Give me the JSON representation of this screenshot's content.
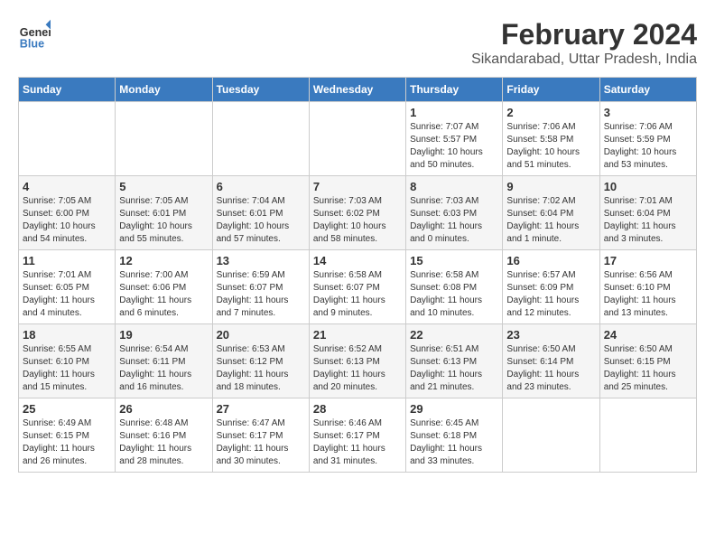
{
  "app": {
    "name_general": "General",
    "name_blue": "Blue",
    "title": "February 2024",
    "subtitle": "Sikandarabad, Uttar Pradesh, India"
  },
  "calendar": {
    "headers": [
      "Sunday",
      "Monday",
      "Tuesday",
      "Wednesday",
      "Thursday",
      "Friday",
      "Saturday"
    ],
    "weeks": [
      [
        {
          "day": "",
          "sunrise": "",
          "sunset": "",
          "daylight": ""
        },
        {
          "day": "",
          "sunrise": "",
          "sunset": "",
          "daylight": ""
        },
        {
          "day": "",
          "sunrise": "",
          "sunset": "",
          "daylight": ""
        },
        {
          "day": "",
          "sunrise": "",
          "sunset": "",
          "daylight": ""
        },
        {
          "day": "1",
          "sunrise": "Sunrise: 7:07 AM",
          "sunset": "Sunset: 5:57 PM",
          "daylight": "Daylight: 10 hours and 50 minutes."
        },
        {
          "day": "2",
          "sunrise": "Sunrise: 7:06 AM",
          "sunset": "Sunset: 5:58 PM",
          "daylight": "Daylight: 10 hours and 51 minutes."
        },
        {
          "day": "3",
          "sunrise": "Sunrise: 7:06 AM",
          "sunset": "Sunset: 5:59 PM",
          "daylight": "Daylight: 10 hours and 53 minutes."
        }
      ],
      [
        {
          "day": "4",
          "sunrise": "Sunrise: 7:05 AM",
          "sunset": "Sunset: 6:00 PM",
          "daylight": "Daylight: 10 hours and 54 minutes."
        },
        {
          "day": "5",
          "sunrise": "Sunrise: 7:05 AM",
          "sunset": "Sunset: 6:01 PM",
          "daylight": "Daylight: 10 hours and 55 minutes."
        },
        {
          "day": "6",
          "sunrise": "Sunrise: 7:04 AM",
          "sunset": "Sunset: 6:01 PM",
          "daylight": "Daylight: 10 hours and 57 minutes."
        },
        {
          "day": "7",
          "sunrise": "Sunrise: 7:03 AM",
          "sunset": "Sunset: 6:02 PM",
          "daylight": "Daylight: 10 hours and 58 minutes."
        },
        {
          "day": "8",
          "sunrise": "Sunrise: 7:03 AM",
          "sunset": "Sunset: 6:03 PM",
          "daylight": "Daylight: 11 hours and 0 minutes."
        },
        {
          "day": "9",
          "sunrise": "Sunrise: 7:02 AM",
          "sunset": "Sunset: 6:04 PM",
          "daylight": "Daylight: 11 hours and 1 minute."
        },
        {
          "day": "10",
          "sunrise": "Sunrise: 7:01 AM",
          "sunset": "Sunset: 6:04 PM",
          "daylight": "Daylight: 11 hours and 3 minutes."
        }
      ],
      [
        {
          "day": "11",
          "sunrise": "Sunrise: 7:01 AM",
          "sunset": "Sunset: 6:05 PM",
          "daylight": "Daylight: 11 hours and 4 minutes."
        },
        {
          "day": "12",
          "sunrise": "Sunrise: 7:00 AM",
          "sunset": "Sunset: 6:06 PM",
          "daylight": "Daylight: 11 hours and 6 minutes."
        },
        {
          "day": "13",
          "sunrise": "Sunrise: 6:59 AM",
          "sunset": "Sunset: 6:07 PM",
          "daylight": "Daylight: 11 hours and 7 minutes."
        },
        {
          "day": "14",
          "sunrise": "Sunrise: 6:58 AM",
          "sunset": "Sunset: 6:07 PM",
          "daylight": "Daylight: 11 hours and 9 minutes."
        },
        {
          "day": "15",
          "sunrise": "Sunrise: 6:58 AM",
          "sunset": "Sunset: 6:08 PM",
          "daylight": "Daylight: 11 hours and 10 minutes."
        },
        {
          "day": "16",
          "sunrise": "Sunrise: 6:57 AM",
          "sunset": "Sunset: 6:09 PM",
          "daylight": "Daylight: 11 hours and 12 minutes."
        },
        {
          "day": "17",
          "sunrise": "Sunrise: 6:56 AM",
          "sunset": "Sunset: 6:10 PM",
          "daylight": "Daylight: 11 hours and 13 minutes."
        }
      ],
      [
        {
          "day": "18",
          "sunrise": "Sunrise: 6:55 AM",
          "sunset": "Sunset: 6:10 PM",
          "daylight": "Daylight: 11 hours and 15 minutes."
        },
        {
          "day": "19",
          "sunrise": "Sunrise: 6:54 AM",
          "sunset": "Sunset: 6:11 PM",
          "daylight": "Daylight: 11 hours and 16 minutes."
        },
        {
          "day": "20",
          "sunrise": "Sunrise: 6:53 AM",
          "sunset": "Sunset: 6:12 PM",
          "daylight": "Daylight: 11 hours and 18 minutes."
        },
        {
          "day": "21",
          "sunrise": "Sunrise: 6:52 AM",
          "sunset": "Sunset: 6:13 PM",
          "daylight": "Daylight: 11 hours and 20 minutes."
        },
        {
          "day": "22",
          "sunrise": "Sunrise: 6:51 AM",
          "sunset": "Sunset: 6:13 PM",
          "daylight": "Daylight: 11 hours and 21 minutes."
        },
        {
          "day": "23",
          "sunrise": "Sunrise: 6:50 AM",
          "sunset": "Sunset: 6:14 PM",
          "daylight": "Daylight: 11 hours and 23 minutes."
        },
        {
          "day": "24",
          "sunrise": "Sunrise: 6:50 AM",
          "sunset": "Sunset: 6:15 PM",
          "daylight": "Daylight: 11 hours and 25 minutes."
        }
      ],
      [
        {
          "day": "25",
          "sunrise": "Sunrise: 6:49 AM",
          "sunset": "Sunset: 6:15 PM",
          "daylight": "Daylight: 11 hours and 26 minutes."
        },
        {
          "day": "26",
          "sunrise": "Sunrise: 6:48 AM",
          "sunset": "Sunset: 6:16 PM",
          "daylight": "Daylight: 11 hours and 28 minutes."
        },
        {
          "day": "27",
          "sunrise": "Sunrise: 6:47 AM",
          "sunset": "Sunset: 6:17 PM",
          "daylight": "Daylight: 11 hours and 30 minutes."
        },
        {
          "day": "28",
          "sunrise": "Sunrise: 6:46 AM",
          "sunset": "Sunset: 6:17 PM",
          "daylight": "Daylight: 11 hours and 31 minutes."
        },
        {
          "day": "29",
          "sunrise": "Sunrise: 6:45 AM",
          "sunset": "Sunset: 6:18 PM",
          "daylight": "Daylight: 11 hours and 33 minutes."
        },
        {
          "day": "",
          "sunrise": "",
          "sunset": "",
          "daylight": ""
        },
        {
          "day": "",
          "sunrise": "",
          "sunset": "",
          "daylight": ""
        }
      ]
    ]
  }
}
